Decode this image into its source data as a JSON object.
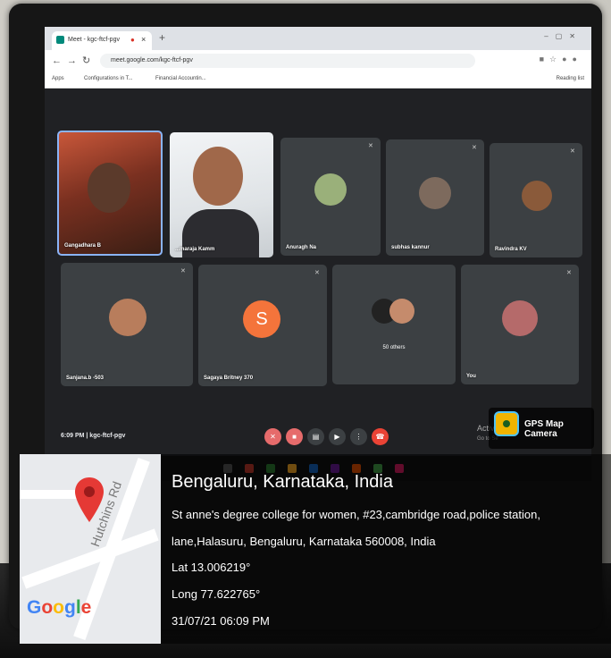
{
  "browser": {
    "tab_title": "Meet - kgc-ftcf-pgv",
    "tab_close": "×",
    "new_tab": "+",
    "url": "meet.google.com/kgc-ftcf-pgv",
    "bookmarks": [
      "Apps",
      "Configurations in T...",
      "Financial Accountin..."
    ],
    "reading_list": "Reading list"
  },
  "meet": {
    "participants": [
      {
        "name": "Gangadhara B"
      },
      {
        "name": "...maraja Kamm"
      },
      {
        "name": "Anuragh Na"
      },
      {
        "name": "subhas kannur"
      },
      {
        "name": "Ravindra KV"
      },
      {
        "name": "Sanjana.b -503"
      },
      {
        "name": "Sagaya Britney 370",
        "initial": "S",
        "color": "#f4743b"
      },
      {
        "name": "50 others"
      },
      {
        "name": "You"
      }
    ],
    "meeting_time": "6:09 PM | kgc-ftcf-pgv",
    "activate_title": "Activa",
    "activate_sub": "Go to Se"
  },
  "watermark": {
    "app_name": "GPS Map Camera",
    "city": "Bengaluru, Karnataka, India",
    "address_line1": "St anne's degree college for women, #23,cambridge road,police station,",
    "address_line2": "lane,Halasuru, Bengaluru, Karnataka 560008, India",
    "lat": "Lat 13.006219°",
    "long": "Long 77.622765°",
    "datetime": "31/07/21 06:09 PM",
    "map_logo": "Google",
    "street_label": "Hutchins Rd",
    "pin_color": "#e53935"
  }
}
